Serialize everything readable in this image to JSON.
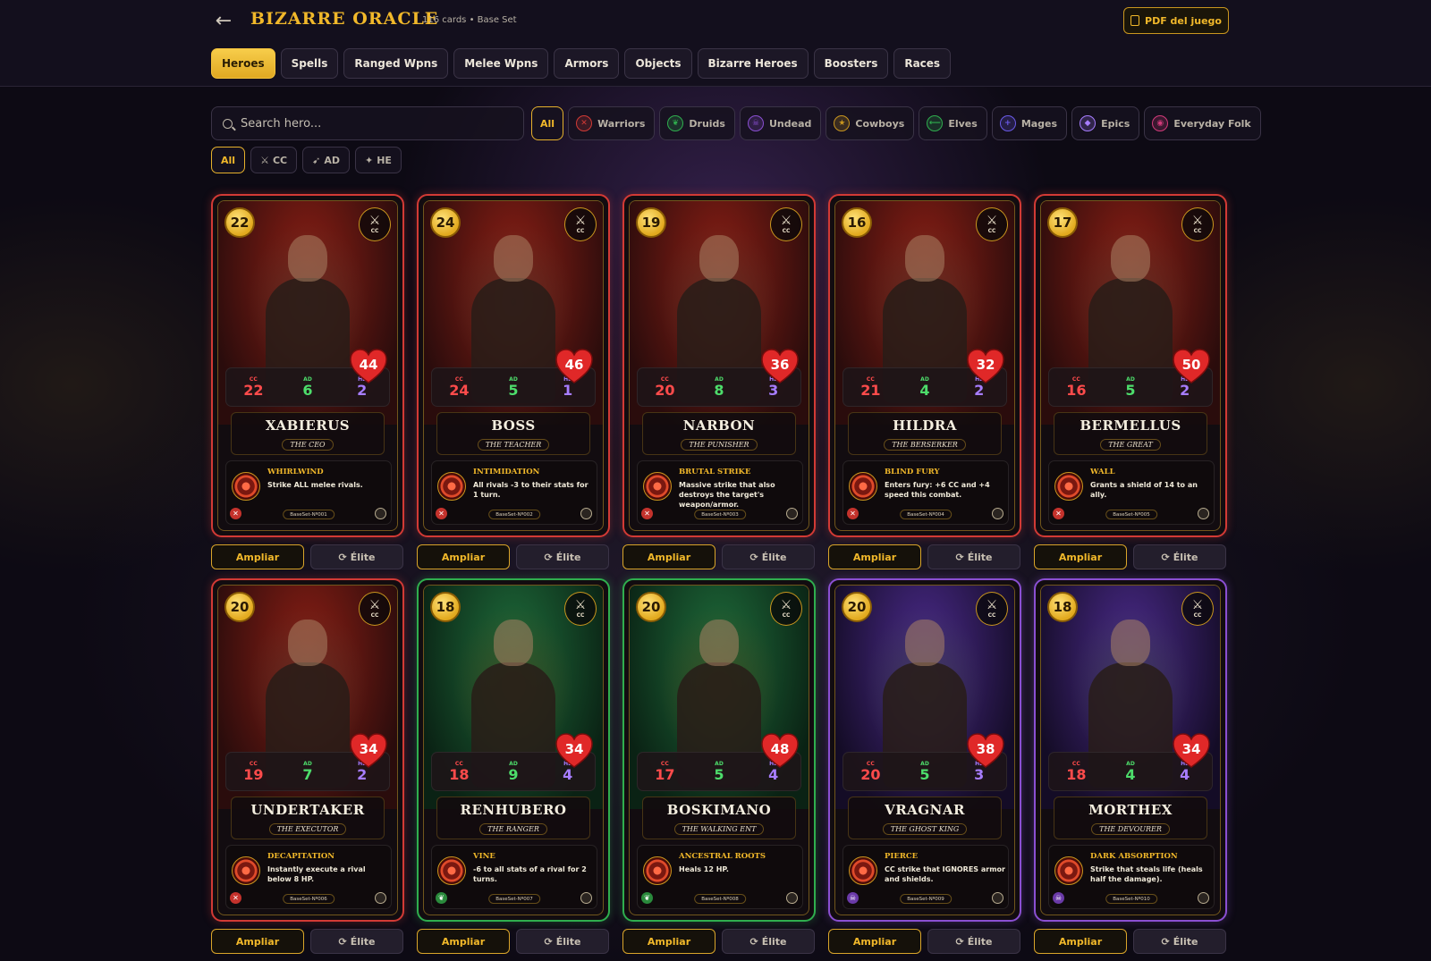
{
  "header": {
    "title": "BIZARRE ORACLE",
    "subtitle": "116 cards • Base Set",
    "pdf_label": "PDF del juego"
  },
  "tabs": [
    "Heroes",
    "Spells",
    "Ranged Wpns",
    "Melee Wpns",
    "Armors",
    "Objects",
    "Bizarre Heroes",
    "Boosters",
    "Races"
  ],
  "active_tab": "Heroes",
  "search": {
    "placeholder": "Search hero..."
  },
  "race_filters": [
    {
      "label": "All",
      "icon": "",
      "color": "#f1b82a"
    },
    {
      "label": "Warriors",
      "icon": "crossed-x-icon",
      "color": "#d23a35"
    },
    {
      "label": "Druids",
      "icon": "leaf-icon",
      "color": "#2fae4e"
    },
    {
      "label": "Undead",
      "icon": "skull-icon",
      "color": "#8a4fd2"
    },
    {
      "label": "Cowboys",
      "icon": "star-icon",
      "color": "#c9961e"
    },
    {
      "label": "Elves",
      "icon": "bow-icon",
      "color": "#2fae4e"
    },
    {
      "label": "Mages",
      "icon": "plus-icon",
      "color": "#6a5ae8"
    },
    {
      "label": "Epics",
      "icon": "diamond-icon",
      "color": "#a77dff"
    },
    {
      "label": "Everyday Folk",
      "icon": "target-icon",
      "color": "#d23a7a"
    }
  ],
  "type_filters": [
    {
      "label": "All",
      "icon": ""
    },
    {
      "label": "CC",
      "icon": "⚔"
    },
    {
      "label": "AD",
      "icon": "➹"
    },
    {
      "label": "HE",
      "icon": "✦"
    }
  ],
  "labels": {
    "cc": "CC",
    "ad": "AD",
    "he": "HE",
    "ampliar": "Ampliar",
    "elite": "Élite",
    "elite_icon": "⟳"
  },
  "cards": [
    {
      "cost": "22",
      "type": "CC",
      "cc": "22",
      "ad": "6",
      "he": "2",
      "hp": "44",
      "name": "XABIERUS",
      "title": "THE CEO",
      "ability": "WHIRLWIND",
      "text": "Strike ALL melee rivals.",
      "code": "BaseSet-Nº001",
      "theme": "red"
    },
    {
      "cost": "24",
      "type": "CC",
      "cc": "24",
      "ad": "5",
      "he": "1",
      "hp": "46",
      "name": "BOSS",
      "title": "THE TEACHER",
      "ability": "INTIMIDATION",
      "text": "All rivals -3 to their stats for 1 turn.",
      "code": "BaseSet-Nº002",
      "theme": "red"
    },
    {
      "cost": "19",
      "type": "CC",
      "cc": "20",
      "ad": "8",
      "he": "3",
      "hp": "36",
      "name": "NARBON",
      "title": "THE PUNISHER",
      "ability": "BRUTAL STRIKE",
      "text": "Massive strike that also destroys the target's weapon/armor.",
      "code": "BaseSet-Nº003",
      "theme": "red"
    },
    {
      "cost": "16",
      "type": "CC",
      "cc": "21",
      "ad": "4",
      "he": "2",
      "hp": "32",
      "name": "HILDRA",
      "title": "THE BERSERKER",
      "ability": "BLIND FURY",
      "text": "Enters fury: +6 CC and +4 speed this combat.",
      "code": "BaseSet-Nº004",
      "theme": "red"
    },
    {
      "cost": "17",
      "type": "CC",
      "cc": "16",
      "ad": "5",
      "he": "2",
      "hp": "50",
      "name": "BERMELLUS",
      "title": "THE GREAT",
      "ability": "WALL",
      "text": "Grants a shield of 14 to an ally.",
      "code": "BaseSet-Nº005",
      "theme": "red"
    },
    {
      "cost": "20",
      "type": "CC",
      "cc": "19",
      "ad": "7",
      "he": "2",
      "hp": "34",
      "name": "UNDERTAKER",
      "title": "THE EXECUTOR",
      "ability": "DECAPITATION",
      "text": "Instantly execute a rival below 8 HP.",
      "code": "BaseSet-Nº006",
      "theme": "red"
    },
    {
      "cost": "18",
      "type": "CC",
      "cc": "18",
      "ad": "9",
      "he": "4",
      "hp": "34",
      "name": "RENHUBERO",
      "title": "THE RANGER",
      "ability": "VINE",
      "text": "-6 to all stats of a rival for 2 turns.",
      "code": "BaseSet-Nº007",
      "theme": "green"
    },
    {
      "cost": "20",
      "type": "CC",
      "cc": "17",
      "ad": "5",
      "he": "4",
      "hp": "48",
      "name": "BOSKIMANO",
      "title": "THE WALKING ENT",
      "ability": "ANCESTRAL ROOTS",
      "text": "Heals 12 HP.",
      "code": "BaseSet-Nº008",
      "theme": "green"
    },
    {
      "cost": "20",
      "type": "CC",
      "cc": "20",
      "ad": "5",
      "he": "3",
      "hp": "38",
      "name": "VRAGNAR",
      "title": "THE GHOST KING",
      "ability": "PIERCE",
      "text": "CC strike that IGNORES armor and shields.",
      "code": "BaseSet-Nº009",
      "theme": "purple"
    },
    {
      "cost": "18",
      "type": "CC",
      "cc": "18",
      "ad": "4",
      "he": "4",
      "hp": "34",
      "name": "MORTHEX",
      "title": "THE DEVOURER",
      "ability": "DARK ABSORPTION",
      "text": "Strike that steals life (heals half the damage).",
      "code": "BaseSet-Nº010",
      "theme": "purple"
    }
  ],
  "colors": {
    "accent": "#f1b82a",
    "warrior": "#d23a35",
    "druid": "#2fae4e",
    "undead": "#8a4fd2"
  }
}
